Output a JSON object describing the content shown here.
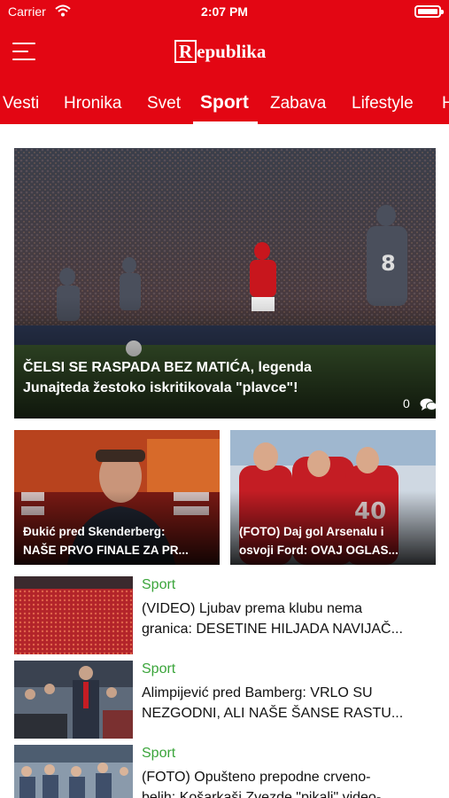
{
  "status_bar": {
    "carrier": "Carrier",
    "time": "2:07 PM",
    "wifi_icon": "wifi-icon",
    "battery_icon": "battery-icon"
  },
  "header": {
    "menu_icon": "hamburger-menu-icon",
    "logo": "Republika",
    "brand_color": "#e30613"
  },
  "tabs": [
    {
      "label": "Vesti",
      "active": false
    },
    {
      "label": "Hronika",
      "active": false
    },
    {
      "label": "Svet",
      "active": false
    },
    {
      "label": "Sport",
      "active": true
    },
    {
      "label": "Zabava",
      "active": false
    },
    {
      "label": "Lifestyle",
      "active": false
    },
    {
      "label": "H",
      "active": false
    }
  ],
  "hero": {
    "title_line1": "ČELSI SE RASPADA BEZ MATIĆA, legenda",
    "title_line2": "Junajteda žestoko iskritikovala \"plavce\"!",
    "comment_count": "0",
    "comment_icon": "comments-icon"
  },
  "cards": [
    {
      "title_line1": "Đukić pred Skenderberg:",
      "title_line2": "NAŠE PRVO FINALE ZA PR..."
    },
    {
      "title_line1": "(FOTO) Daj gol Arsenalu i",
      "title_line2": "osvoji Ford: OVAJ OGLAS..."
    }
  ],
  "list": [
    {
      "category": "Sport",
      "line1": "(VIDEO) Ljubav prema klubu nema",
      "line2": "granica: DESETINE HILJADA NAVIJAČ..."
    },
    {
      "category": "Sport",
      "line1": "Alimpijević pred Bamberg: VRLO SU",
      "line2": "NEZGODNI, ALI NAŠE ŠANSE RASTU..."
    },
    {
      "category": "Sport",
      "line1": "(FOTO) Opušteno prepodne crveno-",
      "line2": "belih: Košarkaši Zvezde \"pikali\" video-"
    }
  ],
  "category_color": "#3ba53b"
}
